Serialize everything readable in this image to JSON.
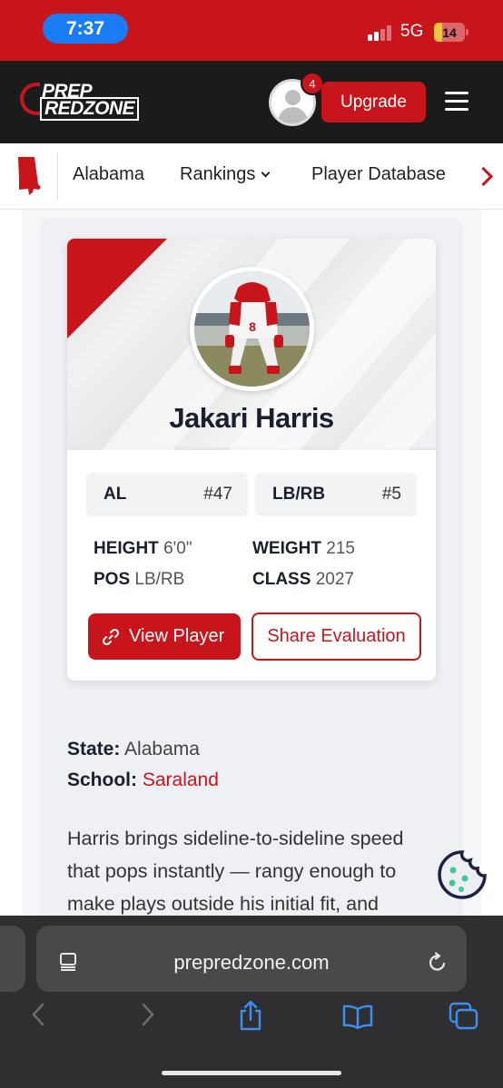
{
  "status_bar": {
    "time": "7:37",
    "network": "5G",
    "battery": "14",
    "battery_level": 0.14,
    "signal_bars_active": 2,
    "signal_bars_total": 4
  },
  "header": {
    "logo_line1": "PREP",
    "logo_line2": "REDZONE",
    "notification_count": "4",
    "upgrade_label": "Upgrade"
  },
  "nav": {
    "items": [
      "Alabama",
      "Rankings",
      "Player Database"
    ]
  },
  "player": {
    "name": "Jakari Harris",
    "state_rank": {
      "label": "AL",
      "value": "#47"
    },
    "position_rank": {
      "label": "LB/RB",
      "value": "#5"
    },
    "height": {
      "label": "HEIGHT",
      "value": "6'0\""
    },
    "weight": {
      "label": "WEIGHT",
      "value": "215"
    },
    "pos": {
      "label": "POS",
      "value": "LB/RB"
    },
    "class": {
      "label": "CLASS",
      "value": "2027"
    },
    "view_label": "View Player",
    "share_label": "Share Evaluation"
  },
  "details": {
    "state_label": "State:",
    "state_value": "Alabama",
    "school_label": "School:",
    "school_value": "Saraland",
    "bio": "Harris brings sideline-to-sideline speed that pops instantly — rangy enough to make plays outside his initial fit, and"
  },
  "browser": {
    "url": "prepredzone.com"
  },
  "colors": {
    "brand_red": "#c8151c",
    "header_dark": "#1b1b1b",
    "ios_blue": "#1a7cf5",
    "safari_blue": "#3d8ff0"
  }
}
